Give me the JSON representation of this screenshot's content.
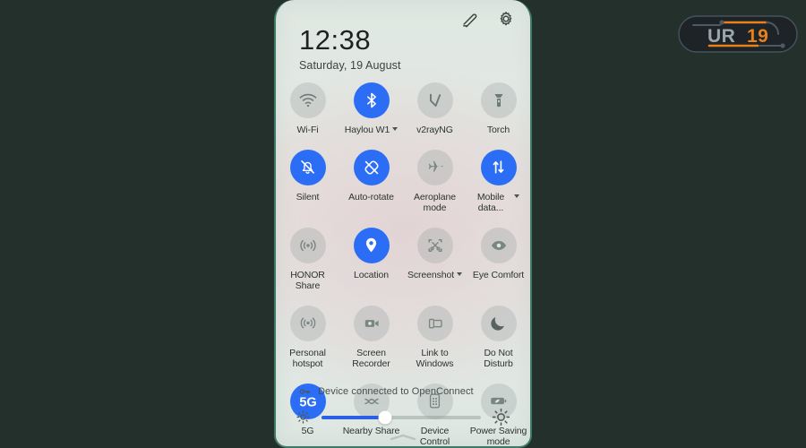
{
  "theme": {
    "page_background": "#24302c",
    "panel_border": "#3f7a66",
    "accent_blue": "#2b6ef5",
    "slider_blue": "#2b5fe8",
    "tile_off": "rgba(150,160,158,0.30)",
    "text_primary": "#1d2320",
    "text_secondary": "#3b4440"
  },
  "header": {
    "edit_icon": "pencil-edit-icon",
    "settings_icon": "gear-icon",
    "time": "12:38",
    "date": "Saturday, 19 August"
  },
  "tiles": [
    [
      {
        "label": "Wi-Fi",
        "icon": "wifi-icon",
        "active": false,
        "dropdown": false
      },
      {
        "label": "Haylou W1",
        "icon": "bluetooth-icon",
        "active": true,
        "dropdown": true
      },
      {
        "label": "v2rayNG",
        "icon": "v2rayng-icon",
        "active": false,
        "dropdown": false
      },
      {
        "label": "Torch",
        "icon": "flashlight-icon",
        "active": false,
        "dropdown": false
      }
    ],
    [
      {
        "label": "Silent",
        "icon": "bell-muted-icon",
        "active": true,
        "dropdown": false
      },
      {
        "label": "Auto-rotate",
        "icon": "auto-rotate-icon",
        "active": true,
        "dropdown": false
      },
      {
        "label": "Aeroplane\nmode",
        "icon": "airplane-icon",
        "active": false,
        "dropdown": false
      },
      {
        "label": "Mobile\ndata...",
        "icon": "mobile-data-icon",
        "active": true,
        "dropdown": true
      }
    ],
    [
      {
        "label": "HONOR\nShare",
        "icon": "honor-share-icon",
        "active": false,
        "dropdown": false
      },
      {
        "label": "Location",
        "icon": "location-pin-icon",
        "active": true,
        "dropdown": false
      },
      {
        "label": "Screenshot",
        "icon": "screenshot-scissors-icon",
        "active": false,
        "dropdown": true
      },
      {
        "label": "Eye Comfort",
        "icon": "eye-icon",
        "active": false,
        "dropdown": false
      }
    ],
    [
      {
        "label": "Personal\nhotspot",
        "icon": "hotspot-icon",
        "active": false,
        "dropdown": false
      },
      {
        "label": "Screen\nRecorder",
        "icon": "video-camera-icon",
        "active": false,
        "dropdown": false
      },
      {
        "label": "Link to\nWindows",
        "icon": "link-to-windows-icon",
        "active": false,
        "dropdown": false
      },
      {
        "label": "Do Not\nDisturb",
        "icon": "moon-icon",
        "active": false,
        "dropdown": false
      }
    ],
    [
      {
        "label": "5G",
        "icon": "5g-text-icon",
        "active": true,
        "dropdown": false
      },
      {
        "label": "Nearby Share",
        "icon": "nearby-share-icon",
        "active": false,
        "dropdown": false
      },
      {
        "label": "Device\nControl",
        "icon": "device-control-icon",
        "active": false,
        "dropdown": false
      },
      {
        "label": "Power Saving\nmode",
        "icon": "battery-saver-icon",
        "active": false,
        "dropdown": false
      }
    ]
  ],
  "footer": {
    "vpn_icon": "key-icon",
    "vpn_text": "Device connected to OpenConnect",
    "brightness_low_icon": "sun-small-icon",
    "brightness_high_icon": "sun-large-icon",
    "brightness_percent": 40,
    "pull_handle_icon": "chevron-handle-icon"
  },
  "watermark": {
    "text_primary": "UR",
    "text_accent": "19",
    "color_primary": "#9aa8ad",
    "color_accent": "#e8821e",
    "background": "#1d2326"
  }
}
